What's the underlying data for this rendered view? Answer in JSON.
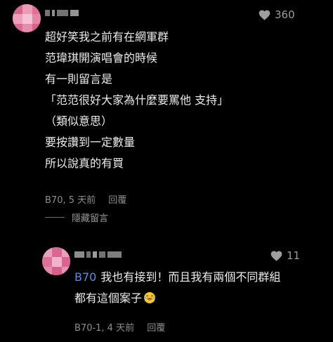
{
  "comment": {
    "likes": "360",
    "lines": [
      "超好笑我之前有在網軍群",
      "范瑋琪開演唱會的時候",
      "有一則留言是",
      "「范范很好大家為什麼要罵他 支持」",
      "（類似意思）",
      "要按讚到一定數量",
      "所以說真的有買"
    ],
    "meta": "B70, 5 天前",
    "reply_label": "回覆"
  },
  "hide_replies_label": "隱藏留言",
  "reply": {
    "likes": "11",
    "mention": "B70",
    "line1": "我也有接到！而且我有兩個不同群組",
    "line2": "都有這個案子",
    "emoji": "face-with-tears-of-joy",
    "meta": "B70-1, 4 天前",
    "reply_label": "回覆"
  },
  "colors": {
    "background": "#000000",
    "text": "#ececec",
    "muted": "#8e8e8e",
    "mention": "#5b8ee0",
    "avatar_main": "#e2799f"
  }
}
